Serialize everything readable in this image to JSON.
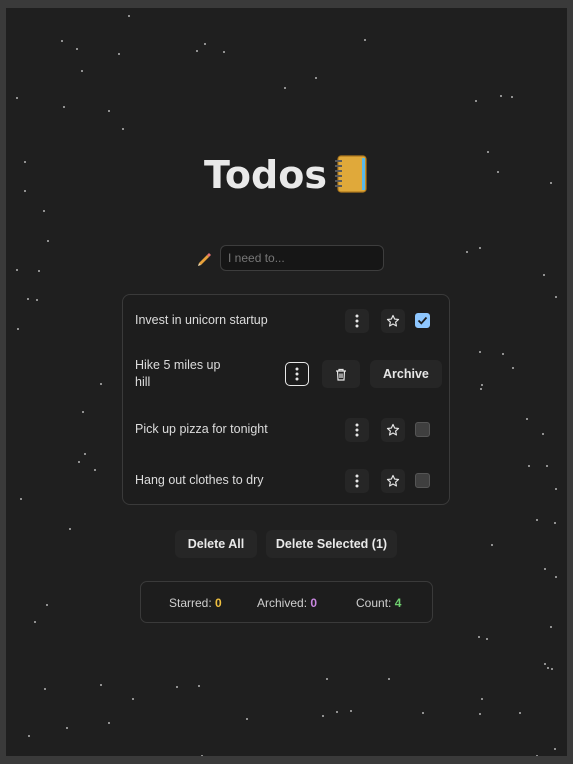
{
  "title": "Todos",
  "input": {
    "placeholder": "I need to...",
    "value": ""
  },
  "todos": [
    {
      "text": "Invest in unicorn startup",
      "starred": false,
      "checked": true
    },
    {
      "text_line1": "Hike 5 miles up",
      "text_line2": "hill",
      "menu_open": true,
      "archive_label": "Archive"
    },
    {
      "text": "Pick up pizza for tonight",
      "starred": false,
      "checked": false
    },
    {
      "text": "Hang out clothes to dry",
      "starred": false,
      "checked": false
    }
  ],
  "actions": {
    "delete_all": "Delete All",
    "delete_selected": "Delete Selected (1)"
  },
  "stats": {
    "starred_label": "Starred:",
    "starred_value": "0",
    "archived_label": "Archived:",
    "archived_value": "0",
    "count_label": "Count:",
    "count_value": "4"
  },
  "colors": {
    "starred": "#f0c040",
    "archived": "#c987e0",
    "count": "#6fcf6f",
    "checkbox_checked": "#8ec7ff"
  },
  "icons": {
    "title": "notebook-icon",
    "input": "pencil-icon",
    "menu": "kebab-menu-icon",
    "star": "star-outline-icon",
    "delete": "trash-icon"
  }
}
